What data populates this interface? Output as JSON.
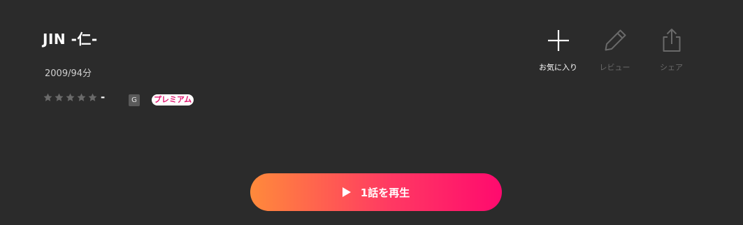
{
  "title": "JIN -仁-",
  "meta": "2009/94分",
  "rating": {
    "stars_total": 5,
    "stars_filled": 0,
    "value": "-"
  },
  "badges": {
    "age": "G",
    "premium": "プレミアム"
  },
  "actions": {
    "favorite": "お気に入り",
    "review": "レビュー",
    "share": "シェア"
  },
  "play_button": {
    "label": "1話を再生"
  },
  "colors": {
    "background": "#2b2b2b",
    "play_gradient_start": "#ff8a3b",
    "play_gradient_end": "#ff0a6e",
    "premium_text": "#e0146e",
    "disabled_icon": "#6a6a6a"
  },
  "icons": {
    "favorite": "plus-icon",
    "review": "pencil-icon",
    "share": "share-icon",
    "play": "play-icon",
    "star": "star-icon"
  }
}
